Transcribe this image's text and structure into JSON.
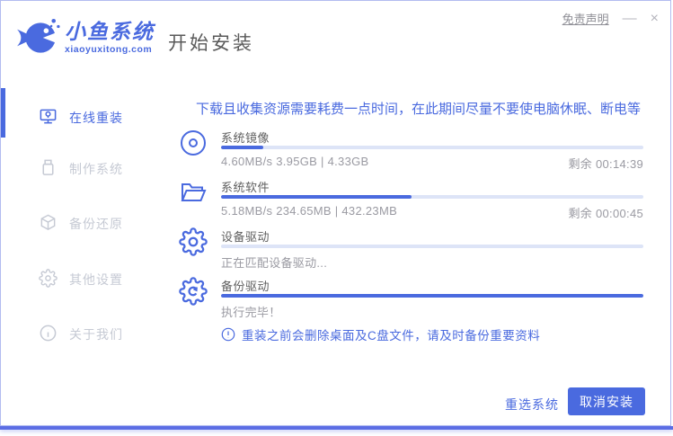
{
  "window": {
    "brand": "小鱼系统",
    "brand_domain": "xiaoyuxitong.com",
    "page_title": "开始安装",
    "titlebar": {
      "disclaimer": "免责声明",
      "minimize": "—",
      "close": "×"
    }
  },
  "sidebar": {
    "items": [
      {
        "label": "在线重装",
        "icon": "monitor-reinstall-icon",
        "active": true
      },
      {
        "label": "制作系统",
        "icon": "usb-drive-icon",
        "active": false
      },
      {
        "label": "备份还原",
        "icon": "backup-box-icon",
        "active": false
      },
      {
        "label": "其他设置",
        "icon": "gear-icon",
        "active": false
      },
      {
        "label": "关于我们",
        "icon": "info-icon",
        "active": false
      }
    ]
  },
  "main": {
    "notice": "下载且收集资源需要耗费一点时间，在此期间尽量不要使电脑休眠、断电等",
    "tasks": [
      {
        "name": "系统镜像",
        "icon": "disc-icon",
        "progress_pct": 10,
        "status_left": "4.60MB/s 3.95GB | 4.33GB",
        "status_right": "剩余 00:14:39"
      },
      {
        "name": "系统软件",
        "icon": "folder-icon",
        "progress_pct": 45,
        "status_left": "5.18MB/s 234.65MB | 432.23MB",
        "status_right": "剩余 00:00:45"
      },
      {
        "name": "设备驱动",
        "icon": "gear-icon",
        "progress_pct": 0,
        "status_left": "正在匹配设备驱动...",
        "status_right": ""
      },
      {
        "name": "备份驱动",
        "icon": "gear-sync-icon",
        "progress_pct": 100,
        "status_left": "执行完毕！",
        "status_right": ""
      }
    ],
    "warning": "重装之前会删除桌面及C盘文件，请及时备份重要资料",
    "footer": {
      "reselect_label": "重选系统",
      "cancel_label": "取消安装"
    }
  },
  "colors": {
    "accent": "#4a6adf",
    "track": "#dde4f7",
    "bottom_strip": "#5b6de4",
    "border": "#b2bcf0",
    "title_gray": "#5f5f5f",
    "status_gray": "#9a9aa2",
    "inactive_gray": "#c6cad4"
  }
}
